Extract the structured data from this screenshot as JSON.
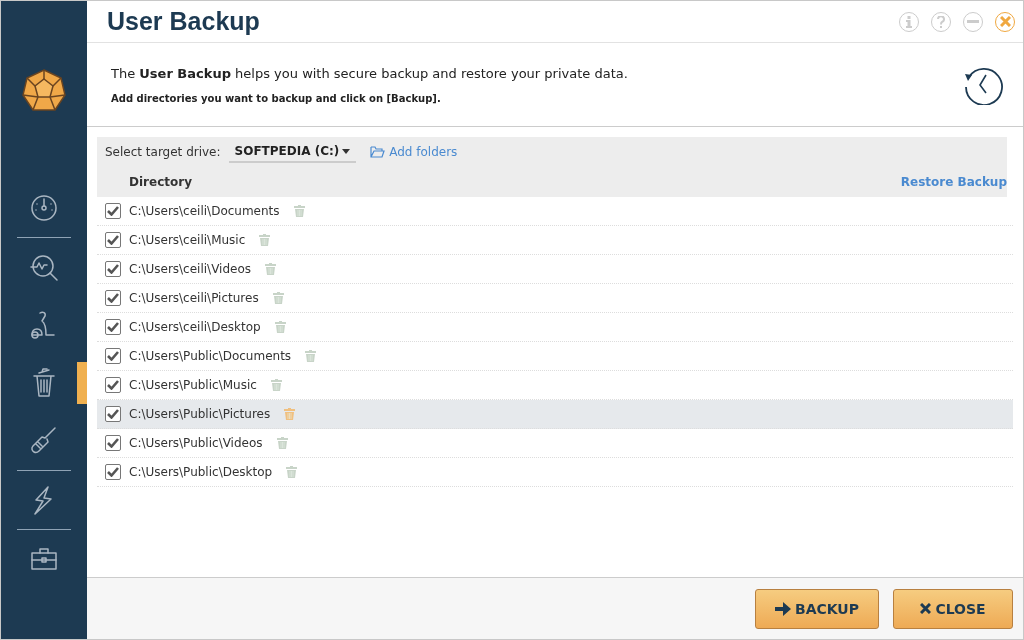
{
  "window": {
    "title": "User Backup"
  },
  "sidebar": {
    "items": [
      {
        "kind": "gauge",
        "selected": false
      },
      {
        "kind": "scan",
        "selected": false
      },
      {
        "kind": "vacuum",
        "selected": false
      },
      {
        "kind": "trash",
        "selected": true
      },
      {
        "kind": "screwdriver",
        "selected": false
      },
      {
        "kind": "bolt",
        "selected": false
      },
      {
        "kind": "toolbox",
        "selected": false
      }
    ]
  },
  "intro": {
    "text": "The **User Backup** helps you with secure backup and restore your private data.",
    "hint": "Add directories you want to backup and click on [Backup]."
  },
  "toolbar": {
    "drive_label": "Select target drive:",
    "drive": "SOFTPEDIA (C:)",
    "add_folders": "Add folders"
  },
  "table": {
    "column": "Directory",
    "restore": "Restore Backup",
    "rows": [
      {
        "path": "C:\\Users\\ceili\\Documents",
        "checked": true,
        "selected": false
      },
      {
        "path": "C:\\Users\\ceili\\Music",
        "checked": true,
        "selected": false
      },
      {
        "path": "C:\\Users\\ceili\\Videos",
        "checked": true,
        "selected": false
      },
      {
        "path": "C:\\Users\\ceili\\Pictures",
        "checked": true,
        "selected": false
      },
      {
        "path": "C:\\Users\\ceili\\Desktop",
        "checked": true,
        "selected": false
      },
      {
        "path": "C:\\Users\\Public\\Documents",
        "checked": true,
        "selected": false
      },
      {
        "path": "C:\\Users\\Public\\Music",
        "checked": true,
        "selected": false
      },
      {
        "path": "C:\\Users\\Public\\Pictures",
        "checked": true,
        "selected": true
      },
      {
        "path": "C:\\Users\\Public\\Videos",
        "checked": true,
        "selected": false
      },
      {
        "path": "C:\\Users\\Public\\Desktop",
        "checked": true,
        "selected": false
      }
    ]
  },
  "buttons": [
    {
      "kind": "backup",
      "label": "BACKUP"
    },
    {
      "kind": "close",
      "label": "CLOSE"
    }
  ]
}
